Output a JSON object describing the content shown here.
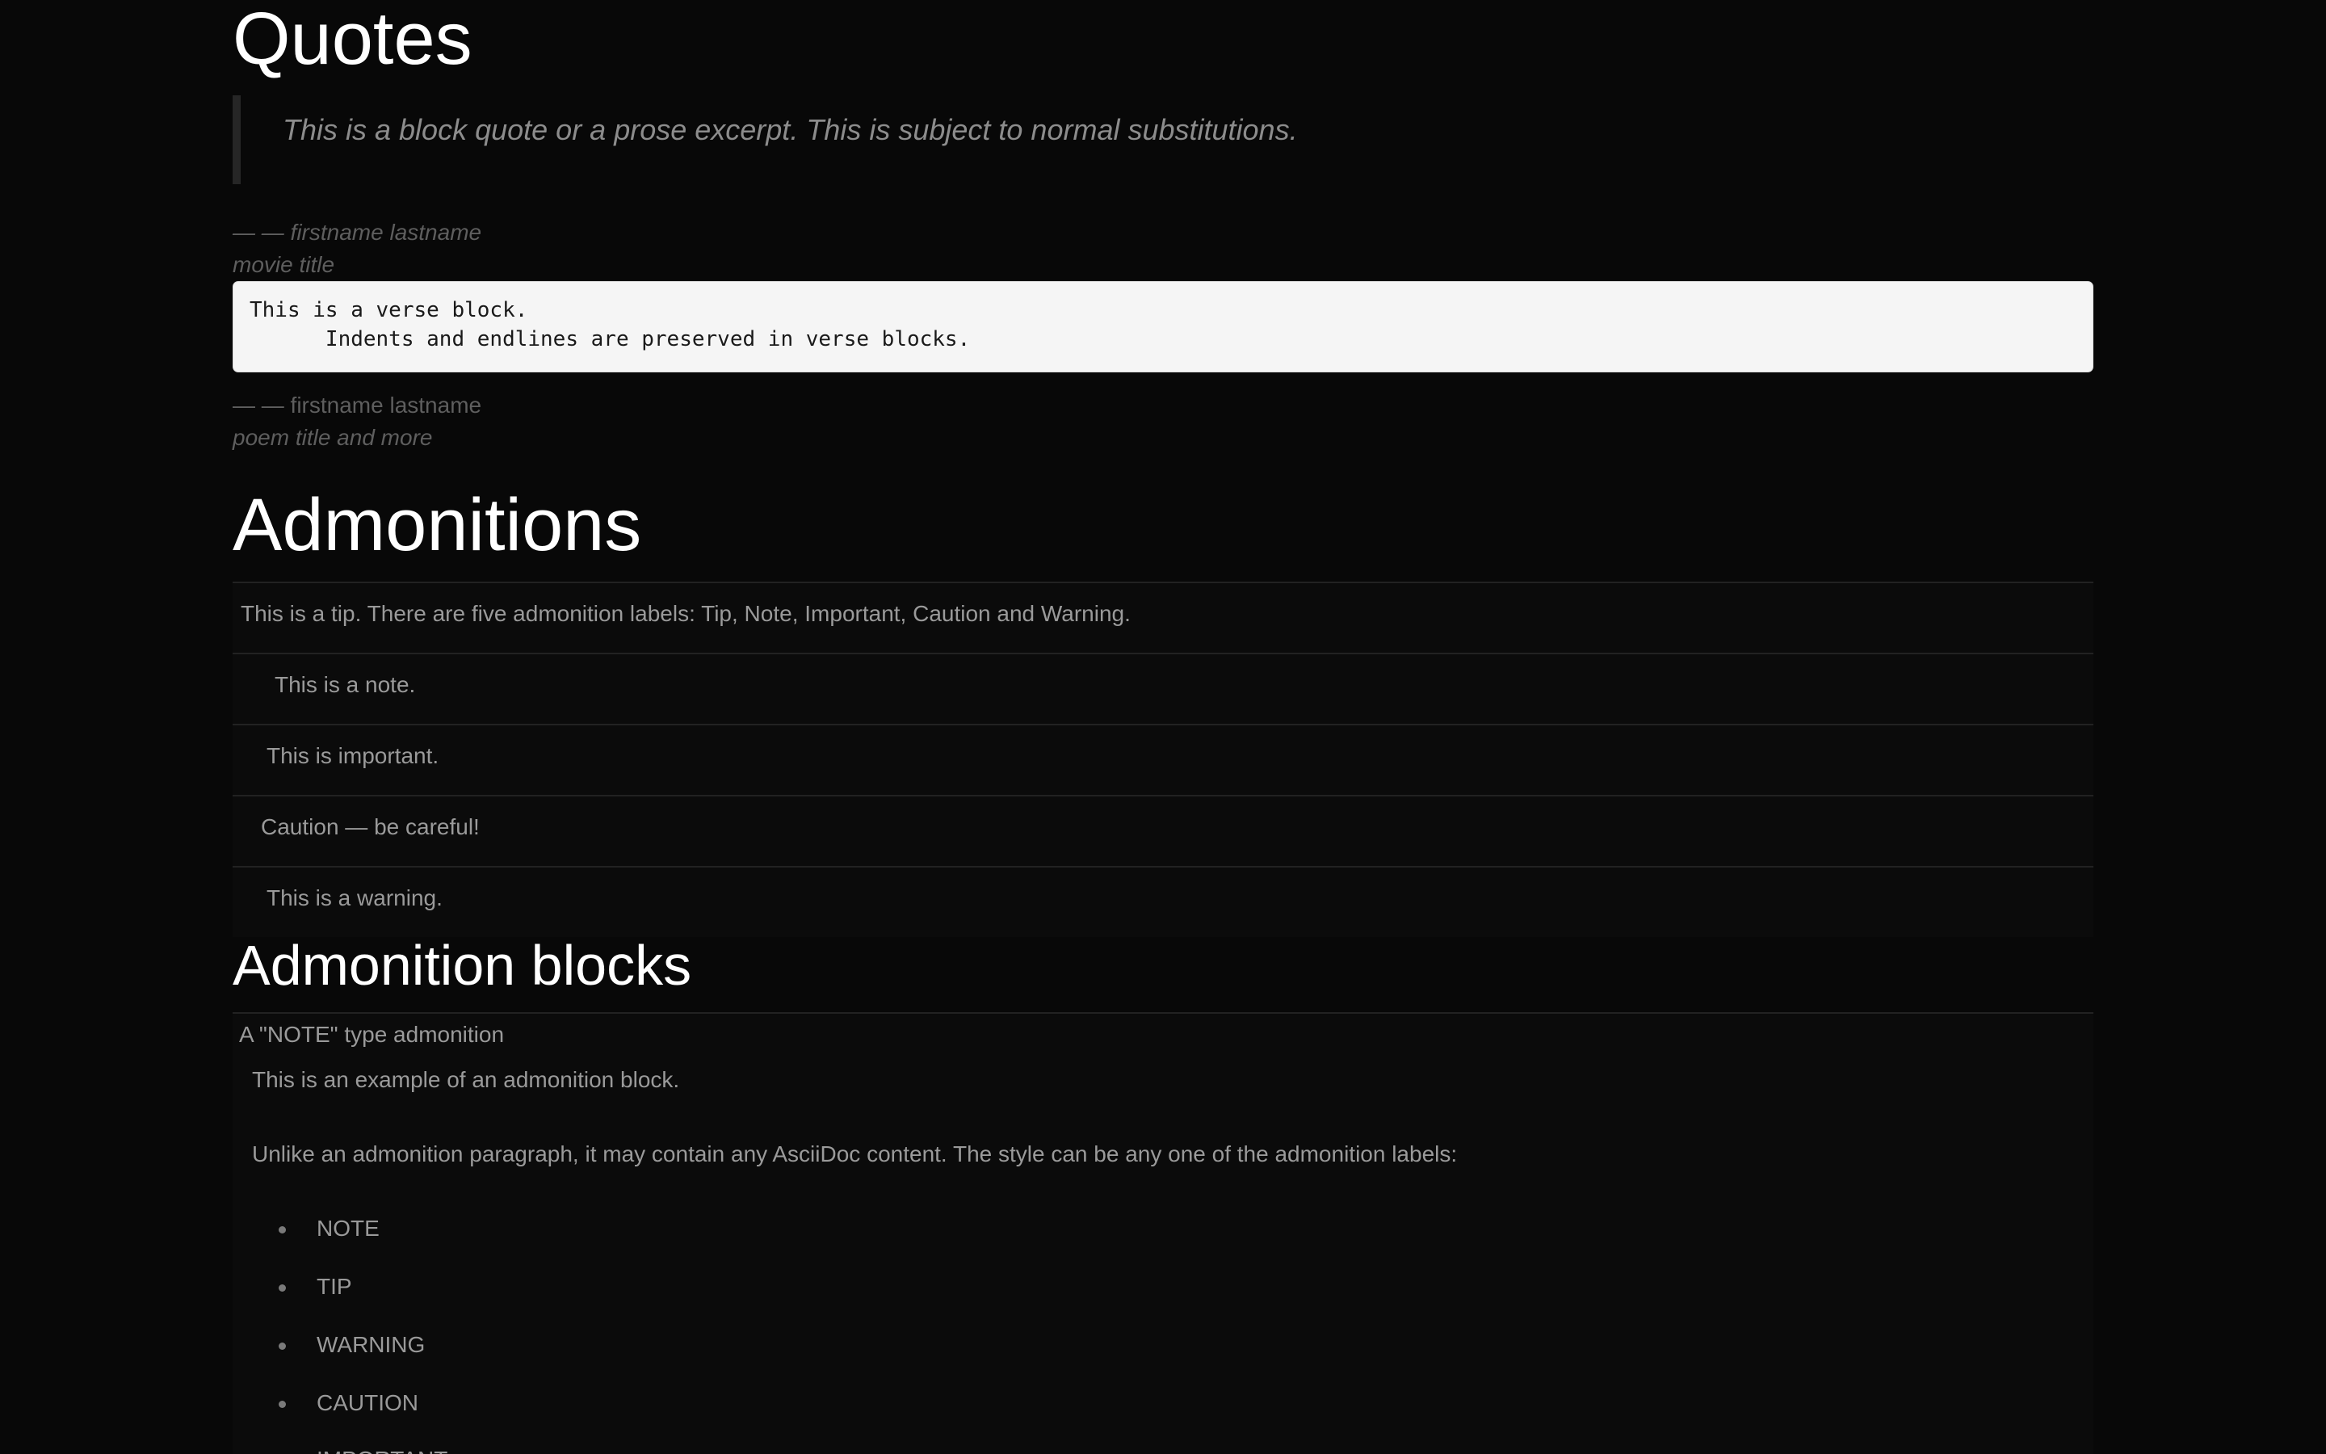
{
  "quotes": {
    "heading": "Quotes",
    "block_quote": "This is a block quote or a prose excerpt. This is subject to normal substitutions.",
    "quote_attribution": "— — firstname lastname",
    "quote_citation": "movie title",
    "verse_lines": [
      "This is a verse block.",
      "      Indents and endlines are preserved in verse blocks."
    ],
    "verse_attribution": "— — firstname lastname",
    "verse_citation": "poem title and more"
  },
  "admonitions": {
    "heading": "Admonitions",
    "items": [
      {
        "type": "tip",
        "text": "This is a tip. There are five admonition labels: Tip, Note, Important, Caution and Warning."
      },
      {
        "type": "note",
        "text": "This is a note."
      },
      {
        "type": "important",
        "text": "This is important."
      },
      {
        "type": "caution",
        "text": "Caution — be careful!"
      },
      {
        "type": "warning",
        "text": "This is a warning."
      }
    ]
  },
  "admonition_blocks": {
    "heading": "Admonition blocks",
    "block_title": "A \"NOTE\" type admonition",
    "paragraphs": [
      "This is an example of an admonition block.",
      "Unlike an admonition paragraph, it may contain any AsciiDoc content. The style can be any one of the admonition labels:"
    ],
    "labels": [
      "NOTE",
      "TIP",
      "WARNING",
      "CAUTION",
      "IMPORTANT"
    ]
  },
  "colors": {
    "background": "#080808",
    "heading": "#ffffff",
    "body_text": "#9a9a9a",
    "muted_text": "#5e5e5e",
    "verse_background": "#f5f5f5"
  }
}
